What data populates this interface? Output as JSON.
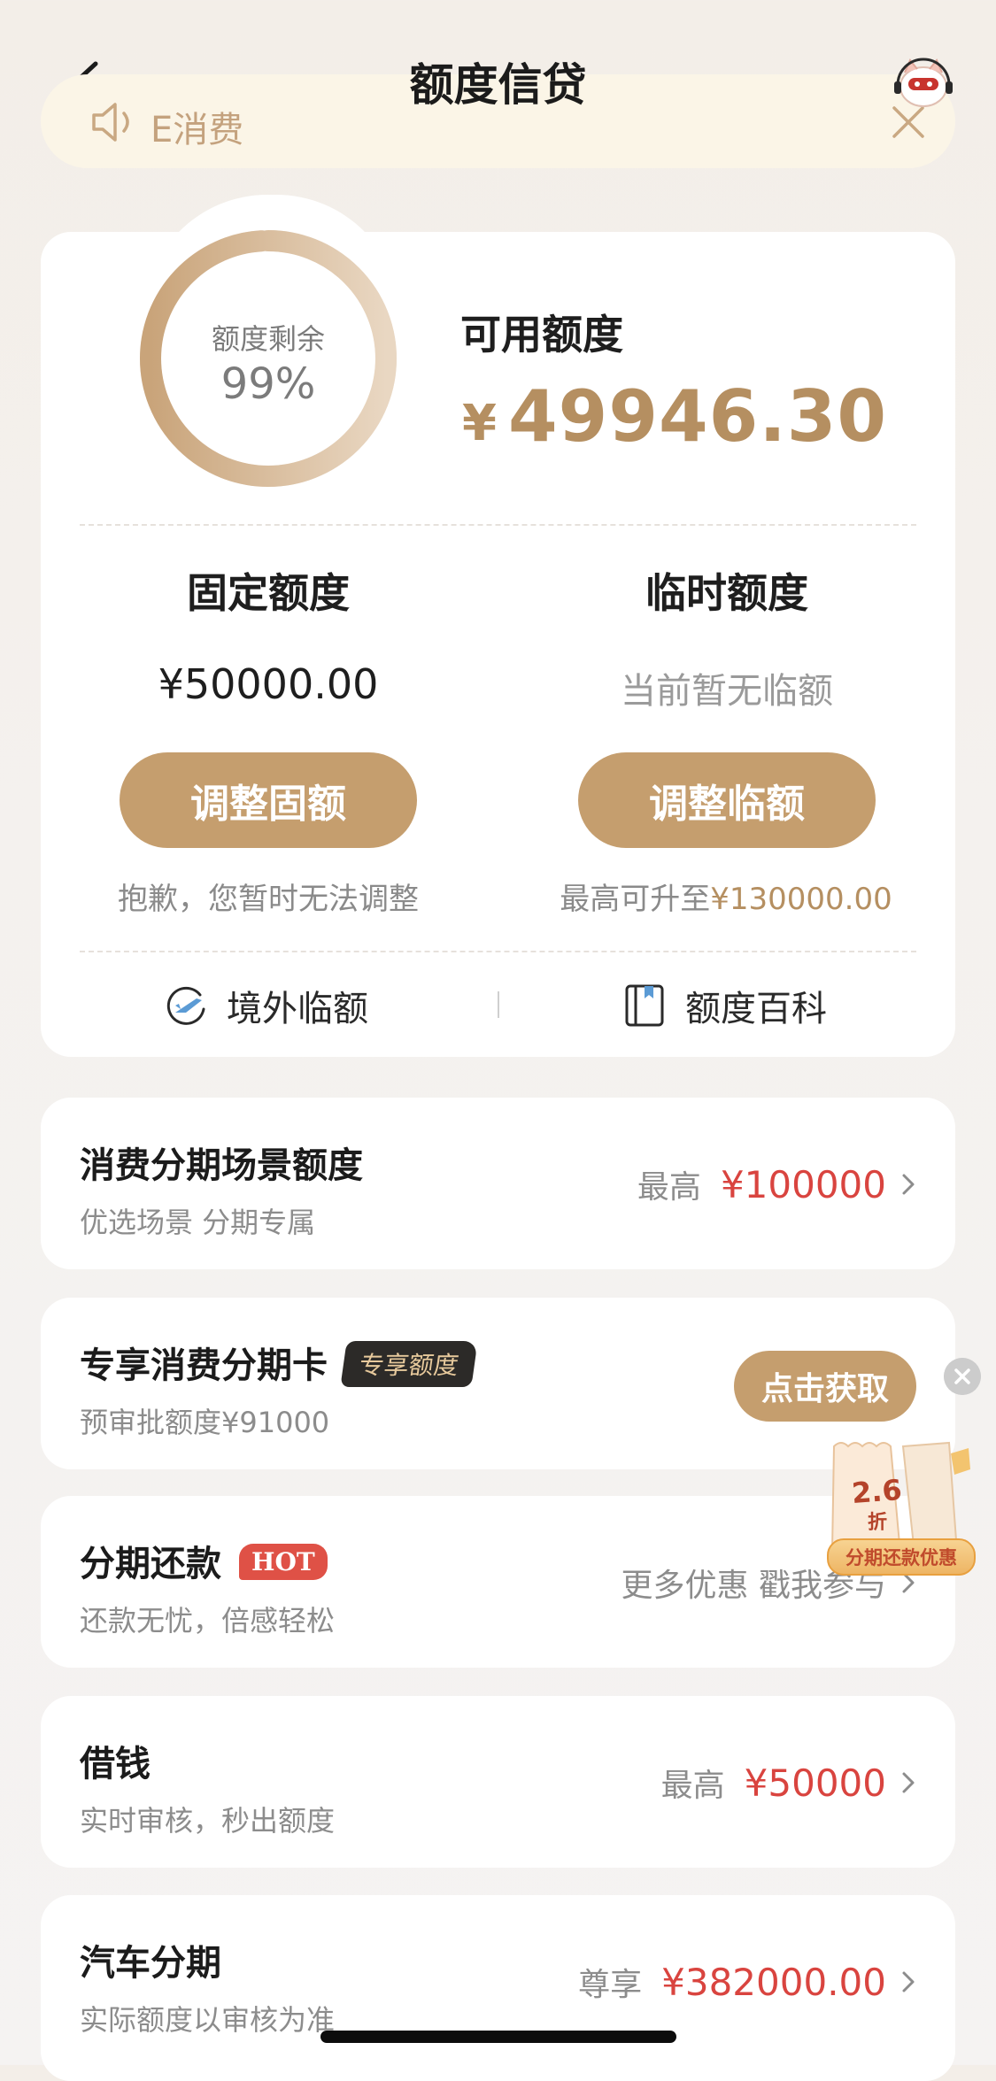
{
  "header": {
    "title": "额度信贷"
  },
  "notice": {
    "text": "E消费"
  },
  "quota": {
    "ring_label": "额度剩余",
    "ring_percent": "99%",
    "ring_fraction": 0.99,
    "available_label": "可用额度",
    "currency": "¥",
    "available_value": "49946.30",
    "fixed_title": "固定额度",
    "fixed_amount": "¥50000.00",
    "fixed_button": "调整固额",
    "fixed_note": "抱歉，您暂时无法调整",
    "temp_title": "临时额度",
    "temp_amount": "当前暂无临额",
    "temp_button": "调整临额",
    "temp_note_prefix": "最高可升至",
    "temp_note_value": "¥130000.00",
    "link_overseas": "境外临额",
    "link_wiki": "额度百科"
  },
  "rows": {
    "r0": {
      "title": "消费分期场景额度",
      "sub": "优选场景 分期专属",
      "right_prefix": "最高",
      "right_value": "¥100000"
    },
    "r1": {
      "title": "专享消费分期卡",
      "badge": "专享额度",
      "sub": "预审批额度¥91000",
      "button": "点击获取"
    },
    "r2": {
      "title": "分期还款",
      "badge": "HOT",
      "sub": "还款无忧，倍感轻松",
      "right_prefix": "更多优惠 戳我参与"
    },
    "r3": {
      "title": "借钱",
      "sub": "实时审核，秒出额度",
      "right_prefix": "最高",
      "right_value": "¥50000"
    },
    "r4": {
      "title": "汽车分期",
      "sub": "实际额度以审核为准",
      "right_prefix": "尊享",
      "right_value": "¥382000.00"
    }
  },
  "promo": {
    "number": "2.6",
    "unit": "折",
    "label": "分期还款优惠"
  },
  "colors": {
    "gold": "#c59e6e",
    "gold_text": "#b58f61",
    "red": "#d9443f",
    "hot": "#df5146"
  }
}
